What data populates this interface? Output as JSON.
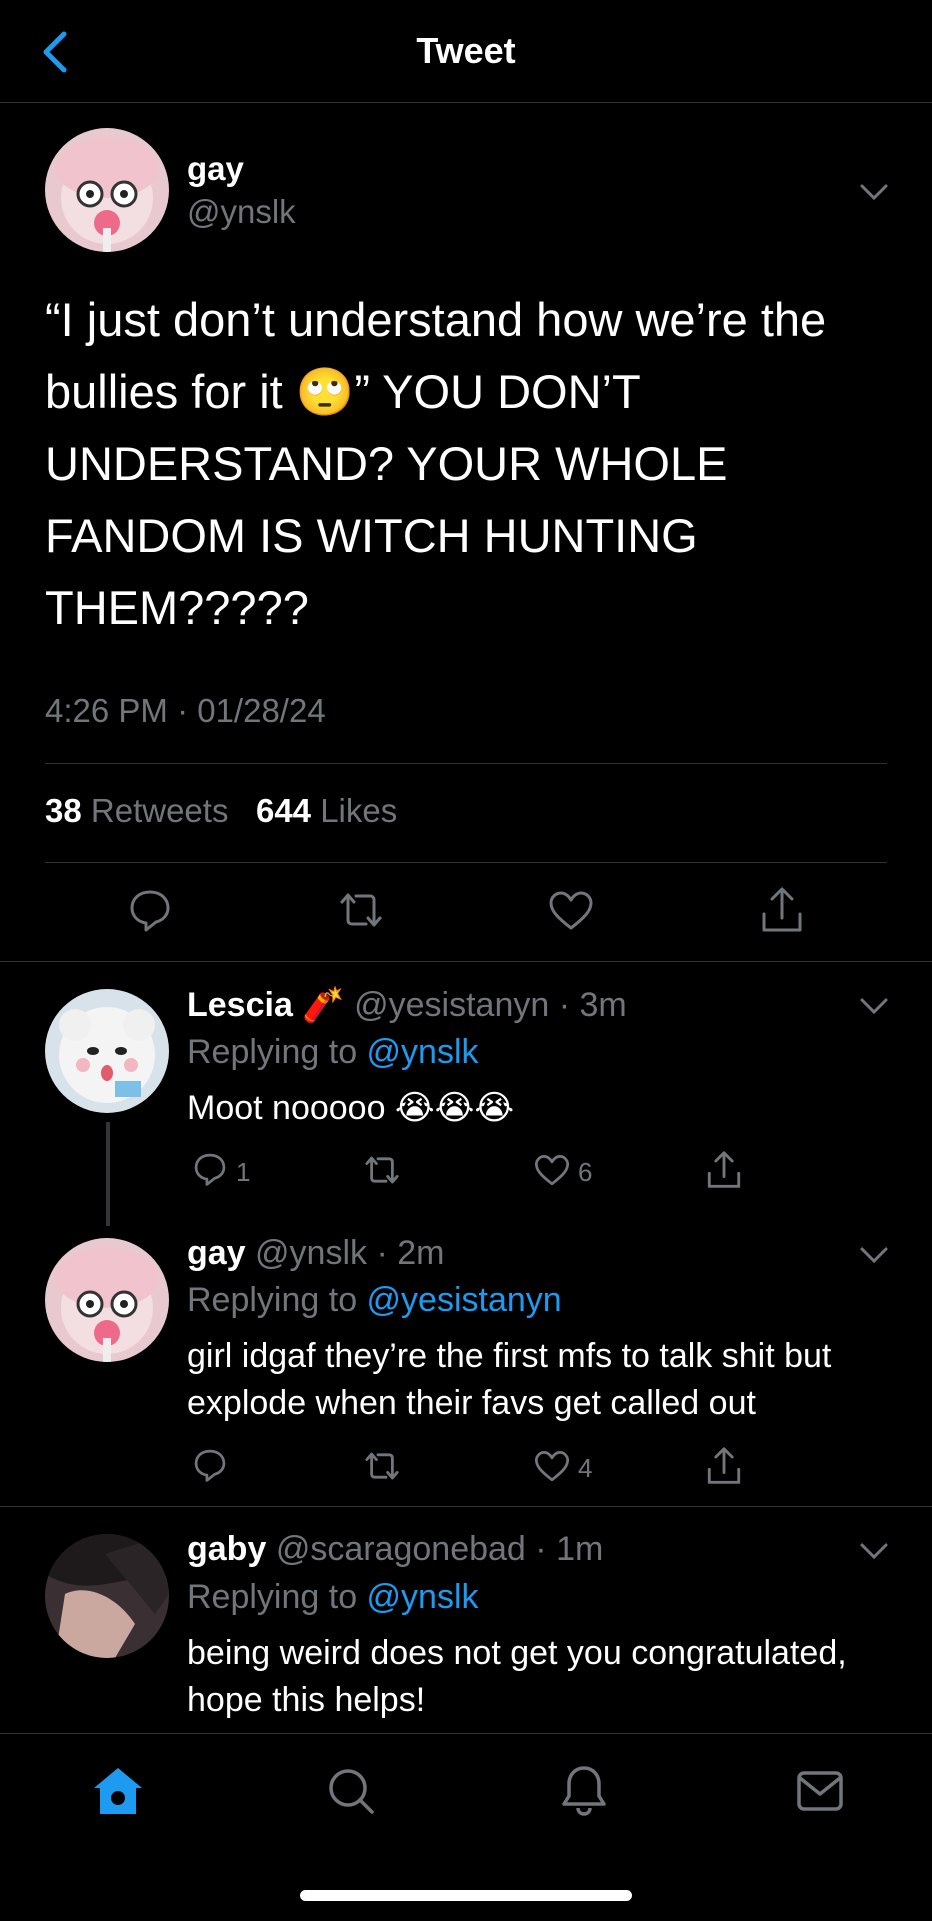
{
  "header": {
    "title": "Tweet"
  },
  "main_tweet": {
    "name": "gay",
    "handle": "@ynslk",
    "text_before_emoji": "“I just don’t understand how we’re the bullies for it ",
    "emoji": "🙄",
    "text_after_emoji": "” YOU DON’T UNDERSTAND? YOUR WHOLE FANDOM IS WITCH HUNTING THEM?????",
    "timestamp": "4:26 PM · 01/28/24",
    "retweets_count": "38",
    "retweets_label": "Retweets",
    "likes_count": "644",
    "likes_label": "Likes"
  },
  "replies": [
    {
      "name": "Lescia",
      "name_emoji": "🧨",
      "handle": "@yesistanyn",
      "time": "3m",
      "replying_prefix": "Replying to ",
      "replying_to": "@ynslk",
      "text": "Moot nooooo 😭😭😭",
      "reply_count": "1",
      "like_count": "6"
    },
    {
      "name": "gay",
      "handle": "@ynslk",
      "time": "2m",
      "replying_prefix": "Replying to ",
      "replying_to": "@yesistanyn",
      "text": "girl idgaf they’re the first mfs to talk shit but explode when their favs get called out",
      "reply_count": "",
      "like_count": "4"
    },
    {
      "name": "gaby",
      "handle": "@scaragonebad",
      "time": "1m",
      "replying_prefix": "Replying to ",
      "replying_to": "@ynslk",
      "text": "being weird does not get you congratulated, hope this helps!"
    }
  ],
  "colors": {
    "accent": "#1d9bf0",
    "muted": "#71767b",
    "divider": "#2f3336"
  }
}
